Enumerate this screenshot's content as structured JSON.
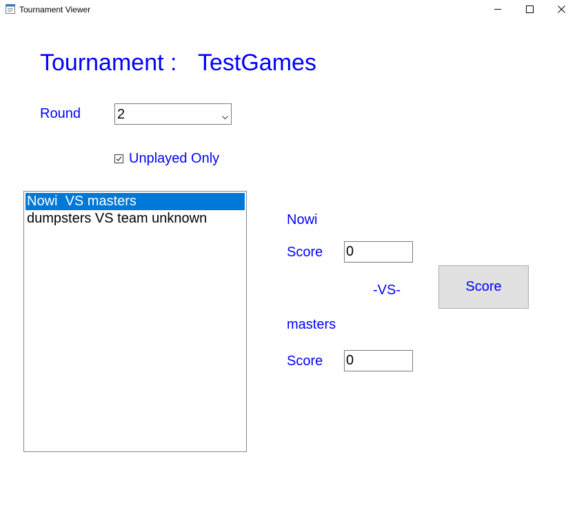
{
  "window": {
    "title": "Tournament Viewer",
    "icons": {
      "app": "app-window-icon",
      "minimize": "minimize-icon",
      "maximize": "maximize-icon",
      "close": "close-icon"
    }
  },
  "header": {
    "label": "Tournament :",
    "tournament_name": "TestGames"
  },
  "round": {
    "label": "Round",
    "selected": "2"
  },
  "filter": {
    "unplayed_only_label": "Unplayed Only",
    "unplayed_only_checked": true
  },
  "matchups": [
    {
      "label": "Nowi  VS masters",
      "selected": true
    },
    {
      "label": "dumpsters VS team unknown",
      "selected": false
    }
  ],
  "match": {
    "team_one_name": "Nowi",
    "team_one_score_label": "Score",
    "team_one_score": "0",
    "vs_label": "-VS-",
    "team_two_name": "masters",
    "team_two_score_label": "Score",
    "team_two_score": "0",
    "score_button_label": "Score"
  },
  "colors": {
    "label_text": "#0000ff",
    "selection": "#0078d7",
    "button_bg": "#e1e1e1"
  }
}
